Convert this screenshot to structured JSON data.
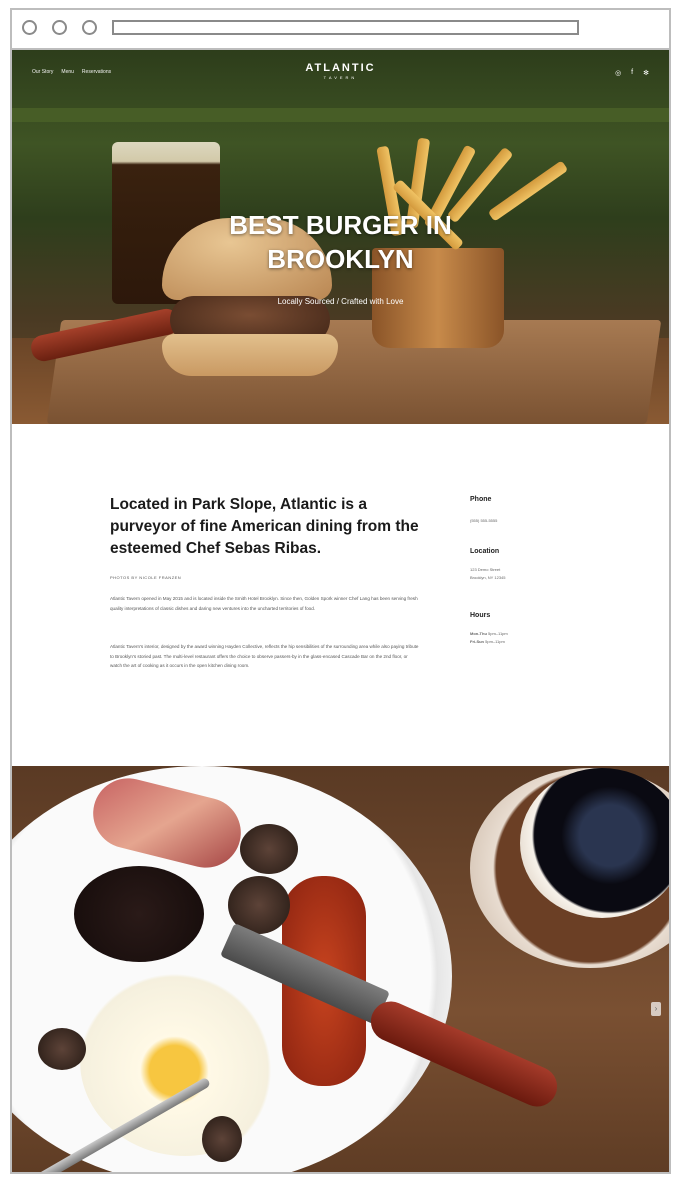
{
  "nav": {
    "links": [
      "Our Story",
      "Menu",
      "Reservations"
    ],
    "brand": "ATLANTIC",
    "brand_sub": "TAVERN",
    "social_icons": [
      "instagram-icon",
      "facebook-icon",
      "yelp-icon"
    ]
  },
  "hero": {
    "headline_line1": "BEST BURGER IN",
    "headline_line2": "BROOKLYN",
    "subline": "Locally Sourced / Crafted with Love"
  },
  "about": {
    "intro": "Located in Park Slope, Atlantic is a purveyor of fine American dining from the esteemed Chef Sebas Ribas.",
    "photo_credit": "PHOTOS BY NICOLE FRANZEN",
    "paragraph1": "Atlantic Tavern opened in May 2015 and is located inside the Smith Hotel Brooklyn. Since then, Golden Spork winner Chef Lang has been serving fresh quality interpretations of classic dishes and daring new ventures into the uncharted territories of food.",
    "paragraph2": "Atlantic Tavern's interior, designed by the award winning Hayden Collective, reflects the hip sensibilities of the surrounding area while also paying tribute to Brooklyn's storied past. The multi-level restaurant offers the choice to observe passers-by in the glass-encased Cascade Bar on the 2nd floor, or watch the art of cooking as it occurs in the open kitchen dining room."
  },
  "info": {
    "phone_label": "Phone",
    "phone_value": "(555) 555-5555",
    "location_label": "Location",
    "address_line1": "123 Demo Street",
    "address_line2": "Brooklyn, NY 12345",
    "hours_label": "Hours",
    "hours_line1_day": "Mon-Thu",
    "hours_line1_time": "5pm–11pm",
    "hours_line2_day": "Fri-Sun",
    "hours_line2_time": "5pm–11pm"
  },
  "colors": {
    "chrome_border": "#bdbdbd",
    "text_dark": "#1b1b1b",
    "text_muted": "#555555"
  }
}
